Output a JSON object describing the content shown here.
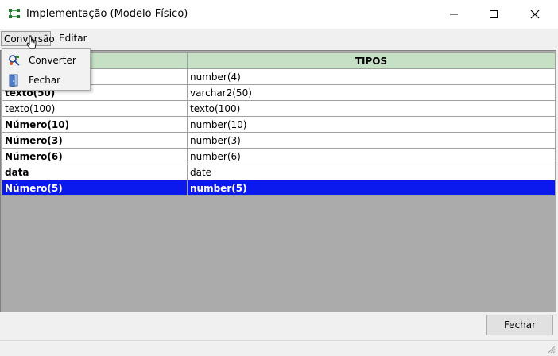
{
  "window": {
    "title": "Implementação (Modelo Físico)"
  },
  "menubar": {
    "items": [
      {
        "label": "Conversão"
      },
      {
        "label": "Editar"
      }
    ]
  },
  "dropdown": {
    "items": [
      {
        "label": "Converter",
        "icon": "convert-icon"
      },
      {
        "label": "Fechar",
        "icon": "door-icon"
      }
    ]
  },
  "grid": {
    "header": {
      "col1": "",
      "col2": "TIPOS"
    },
    "rows": [
      {
        "col1": "",
        "col2": "number(4)"
      },
      {
        "col1": "texto(50)",
        "col2": "varchar2(50)"
      },
      {
        "col1": "texto(100)",
        "col2": "texto(100)"
      },
      {
        "col1": "Número(10)",
        "col2": "number(10)"
      },
      {
        "col1": "Número(3)",
        "col2": "number(3)"
      },
      {
        "col1": "Número(6)",
        "col2": "number(6)"
      },
      {
        "col1": "data",
        "col2": "date"
      },
      {
        "col1": "Número(5)",
        "col2": "number(5)",
        "selected": true
      }
    ],
    "header_color": "#c5e0c4",
    "selection_color": "#0b18ee"
  },
  "footer": {
    "close_button": "Fechar"
  }
}
